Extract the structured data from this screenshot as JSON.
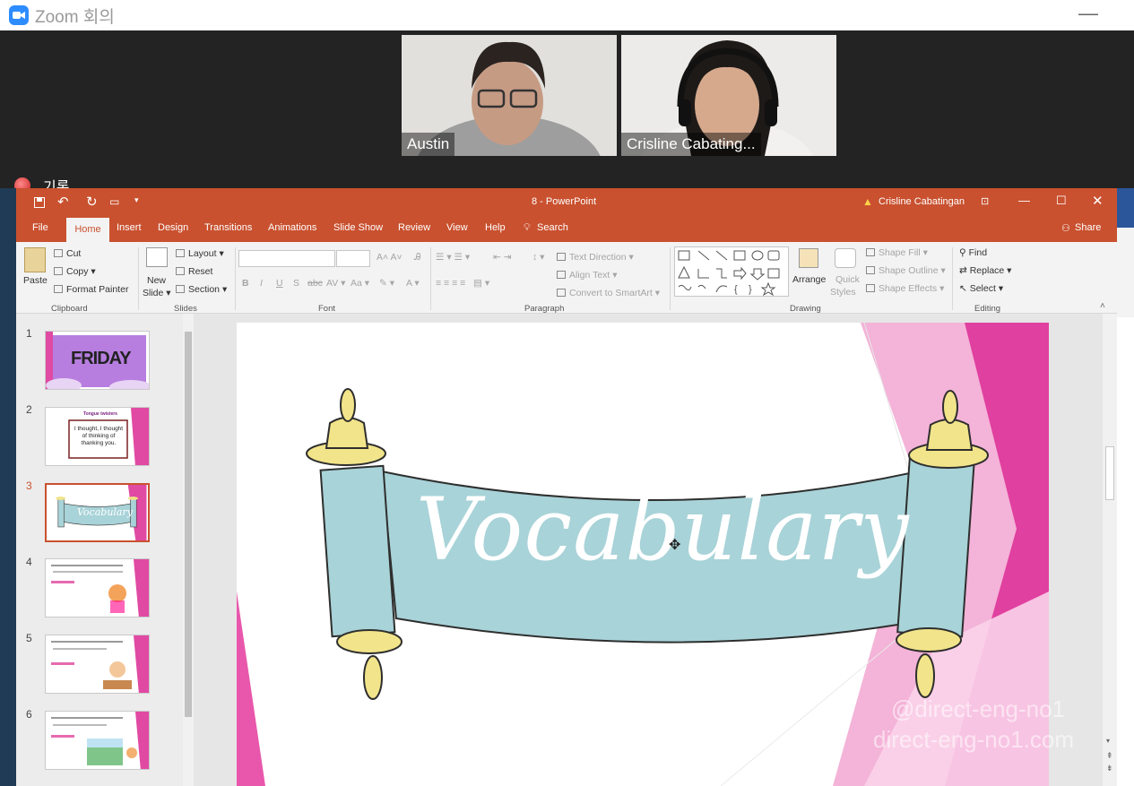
{
  "zoom": {
    "title": "Zoom 회의",
    "participants": [
      {
        "name": "Austin"
      },
      {
        "name": "Crisline Cabating..."
      }
    ],
    "recording_label": "기록"
  },
  "ppt": {
    "title": "8  -  PowerPoint",
    "user": "Crisline Cabatingan",
    "share": "Share",
    "tabs": [
      "File",
      "Home",
      "Insert",
      "Design",
      "Transitions",
      "Animations",
      "Slide Show",
      "Review",
      "View",
      "Help"
    ],
    "search": "Search",
    "ribbon": {
      "clipboard": {
        "paste": "Paste",
        "cut": "Cut",
        "copy": "Copy",
        "format_painter": "Format Painter",
        "group": "Clipboard"
      },
      "slides": {
        "new_slide_1": "New",
        "new_slide_2": "Slide",
        "layout": "Layout",
        "reset": "Reset",
        "section": "Section",
        "group": "Slides"
      },
      "font": {
        "group": "Font"
      },
      "paragraph": {
        "text_direction": "Text Direction",
        "align_text": "Align Text",
        "convert": "Convert to SmartArt",
        "group": "Paragraph"
      },
      "drawing": {
        "arrange": "Arrange",
        "quick_styles_1": "Quick",
        "quick_styles_2": "Styles",
        "shape_fill": "Shape Fill",
        "shape_outline": "Shape Outline",
        "shape_effects": "Shape Effects",
        "group": "Drawing"
      },
      "editing": {
        "find": "Find",
        "replace": "Replace",
        "select": "Select",
        "group": "Editing"
      }
    },
    "slides": [
      {
        "num": "1",
        "text": "FRIDAY"
      },
      {
        "num": "2",
        "title": "Tongue twisters",
        "text": "I thought, I thought of thinking of thanking you."
      },
      {
        "num": "3",
        "text": "Vocabulary",
        "selected": true
      },
      {
        "num": "4"
      },
      {
        "num": "5"
      },
      {
        "num": "6"
      }
    ],
    "current_slide": {
      "word": "Vocabulary"
    }
  },
  "watermark": {
    "line1": "@direct-eng-no1",
    "line2": "direct-eng-no1.com"
  },
  "colors": {
    "ppt_accent": "#c9512f",
    "slide_pink": "#e0409f",
    "scroll_blue": "#a8d3d8",
    "scroll_gold": "#f2e48a"
  }
}
